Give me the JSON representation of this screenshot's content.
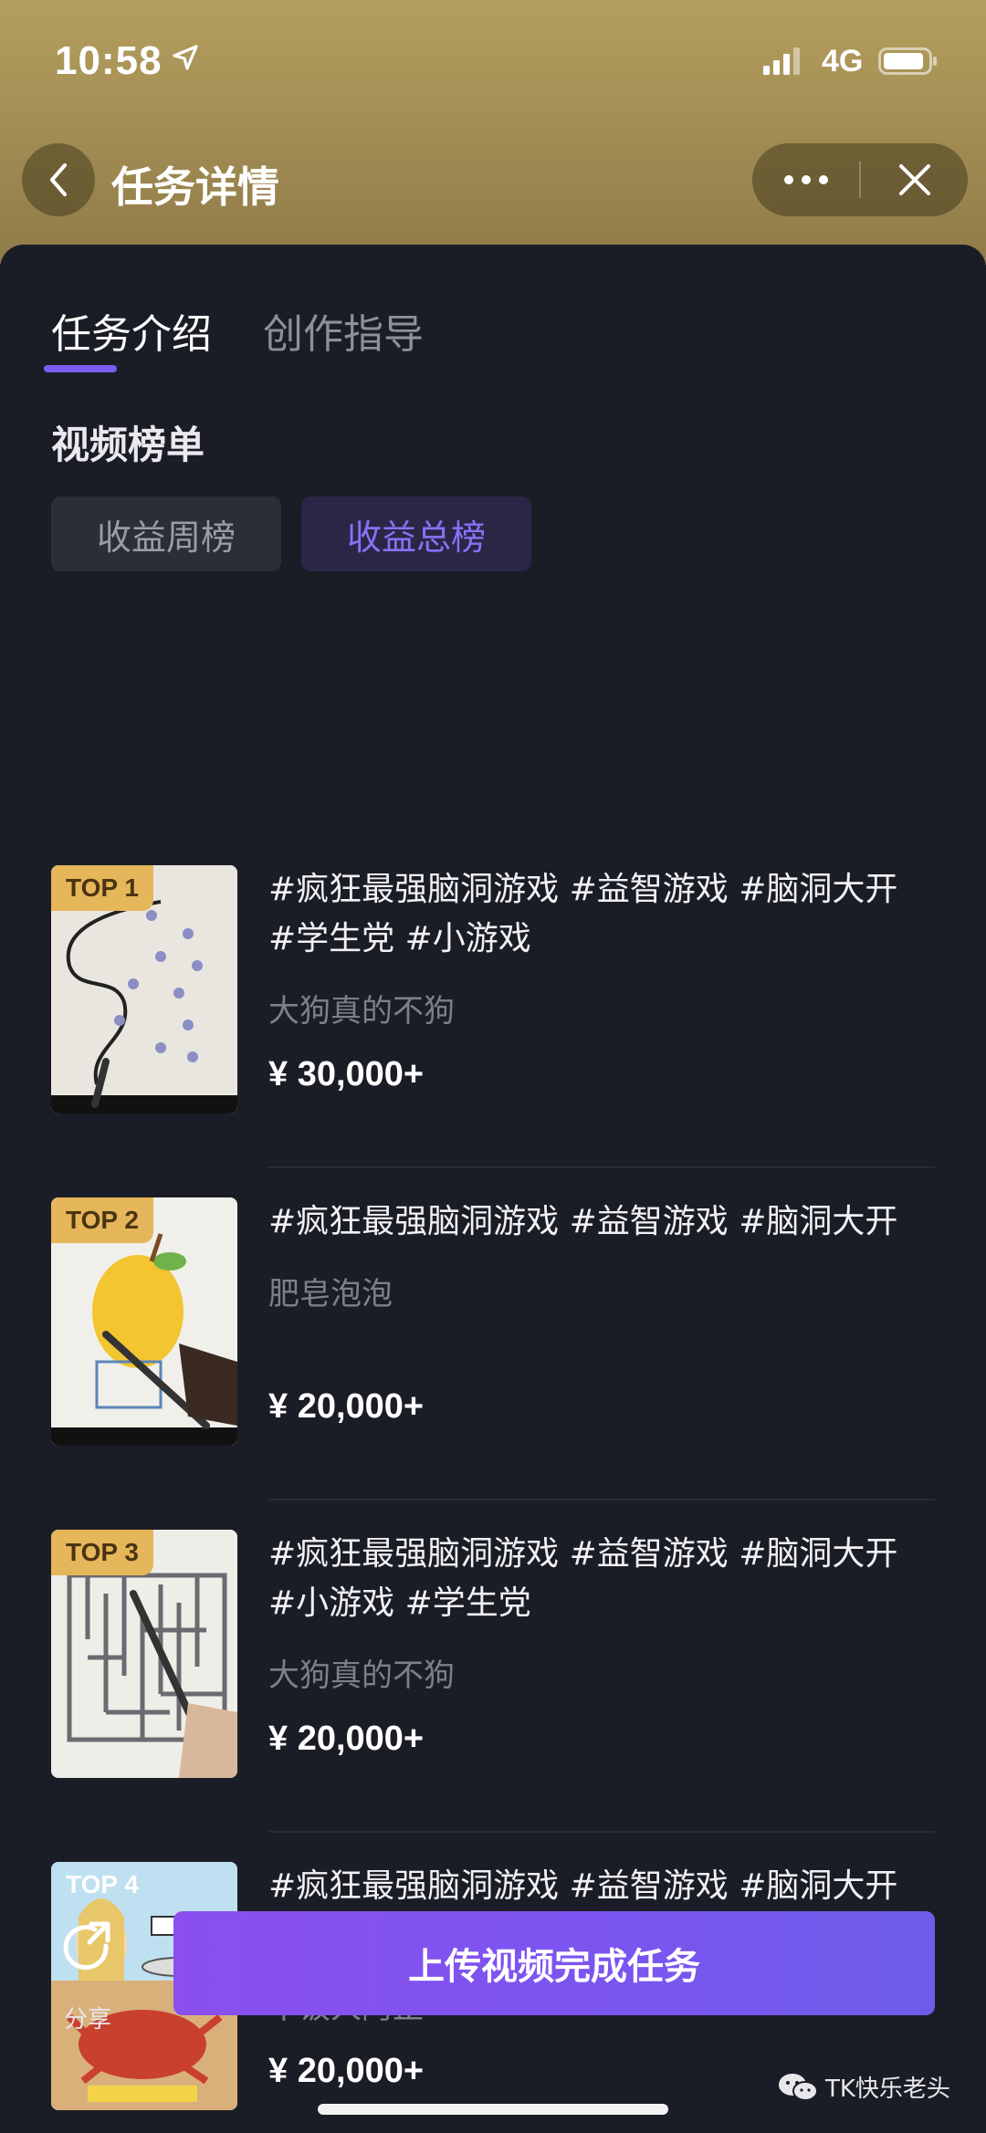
{
  "status_bar": {
    "time": "10:58",
    "network": "4G"
  },
  "navbar": {
    "title": "任务详情"
  },
  "tabs": [
    {
      "label": "任务介绍",
      "active": true
    },
    {
      "label": "创作指导",
      "active": false
    }
  ],
  "section": {
    "title": "视频榜单"
  },
  "filters": [
    {
      "label": "收益周榜",
      "active": false
    },
    {
      "label": "收益总榜",
      "active": true
    }
  ],
  "items": [
    {
      "rank": "TOP 1",
      "title": "#疯狂最强脑洞游戏 #益智游戏 #脑洞大开 #学生党 #小游戏",
      "author": "大狗真的不狗",
      "price": "¥ 30,000+"
    },
    {
      "rank": "TOP 2",
      "title": "#疯狂最强脑洞游戏 #益智游戏 #脑洞大开",
      "author": "肥皂泡泡",
      "price": "¥ 20,000+"
    },
    {
      "rank": "TOP 3",
      "title": "#疯狂最强脑洞游戏 #益智游戏 #脑洞大开 #小游戏 #学生党",
      "author": "大狗真的不狗",
      "price": "¥ 20,000+"
    },
    {
      "rank": "TOP 4",
      "title": "#疯狂最强脑洞游戏 #益智游戏 #脑洞大开 #小游戏夏日合集",
      "author": "干饭人阿正",
      "price": "¥ 20,000+"
    }
  ],
  "bottom_bar": {
    "share_label": "分享",
    "cta_label": "上传视频完成任务"
  },
  "watermark": {
    "text": "TK快乐老头"
  },
  "colors": {
    "accent": "#7a5cf0",
    "badge": "#e6b65a",
    "header": "#a48e55",
    "background": "#1b1d26"
  }
}
